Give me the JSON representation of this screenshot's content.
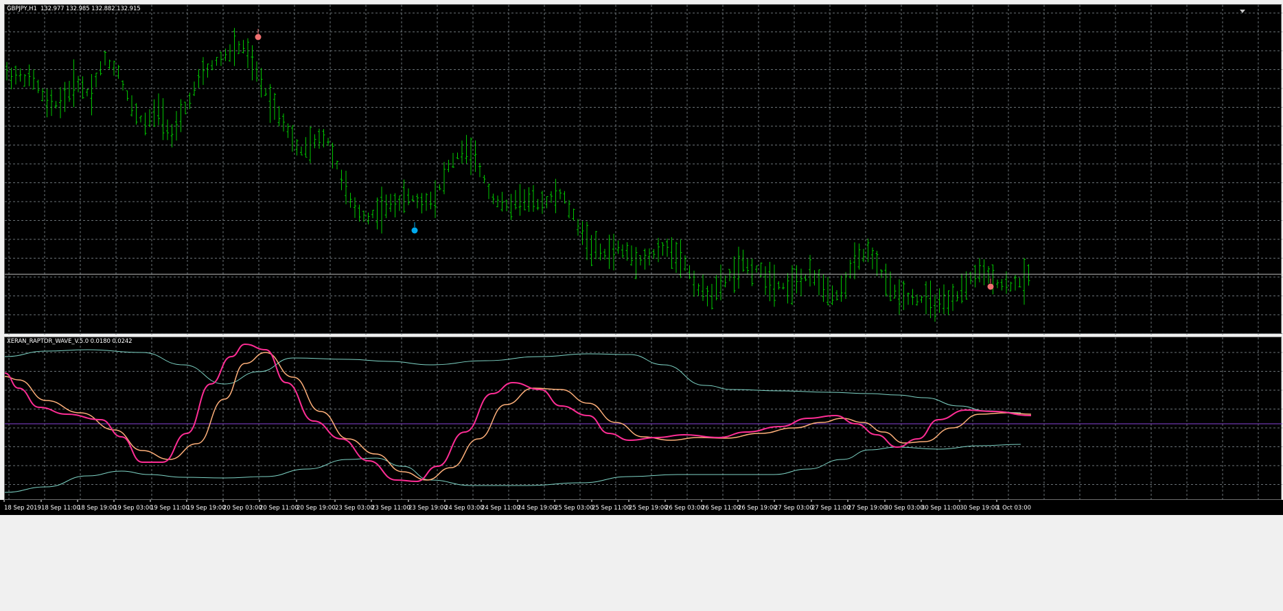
{
  "chart_data": [
    {
      "type": "bar",
      "title": "GBPJPY,H1  132.977 132.985 132.882 132.915",
      "symbol": "GBPJPY",
      "timeframe": "H1",
      "last_bar": {
        "open": 132.977,
        "high": 132.985,
        "low": 132.882,
        "close": 132.915
      },
      "categories": [
        "18 Sep 2019",
        "18 Sep 11:00",
        "18 Sep 19:00",
        "19 Sep 03:00",
        "19 Sep 11:00",
        "19 Sep 19:00",
        "20 Sep 03:00",
        "20 Sep 11:00",
        "20 Sep 19:00",
        "23 Sep 03:00",
        "23 Sep 11:00",
        "23 Sep 19:00",
        "24 Sep 03:00",
        "24 Sep 11:00",
        "24 Sep 19:00",
        "25 Sep 03:00",
        "25 Sep 11:00",
        "25 Sep 19:00",
        "26 Sep 03:00",
        "26 Sep 11:00",
        "26 Sep 19:00",
        "27 Sep 03:00",
        "27 Sep 11:00",
        "27 Sep 19:00",
        "30 Sep 03:00",
        "30 Sep 11:00",
        "30 Sep 19:00",
        "1 Oct 03:00"
      ],
      "bar_color": "#00c800",
      "grid": true,
      "markers": [
        {
          "type": "sell-signal",
          "bar": 66,
          "color": "#f07070"
        },
        {
          "type": "buy-signal",
          "bar": 103,
          "color": "#00aaee"
        },
        {
          "type": "sell-signal",
          "bar": 259,
          "color": "#f07070"
        }
      ]
    },
    {
      "type": "line",
      "title": "XERAN_RAPTOR_WAVE_V.5.0 0.0180 0.0242",
      "grid": true,
      "series": []
    }
  ],
  "colors": {
    "background": "#000000",
    "grid": "#6b7378",
    "price_bars": "#00c800",
    "bid_line": "#c0c0c0",
    "zero_line": "#8a44d8",
    "fast_line": "#ff2d95",
    "slow_line": "#ffb07a",
    "band_lines": "#7fd6c8"
  }
}
